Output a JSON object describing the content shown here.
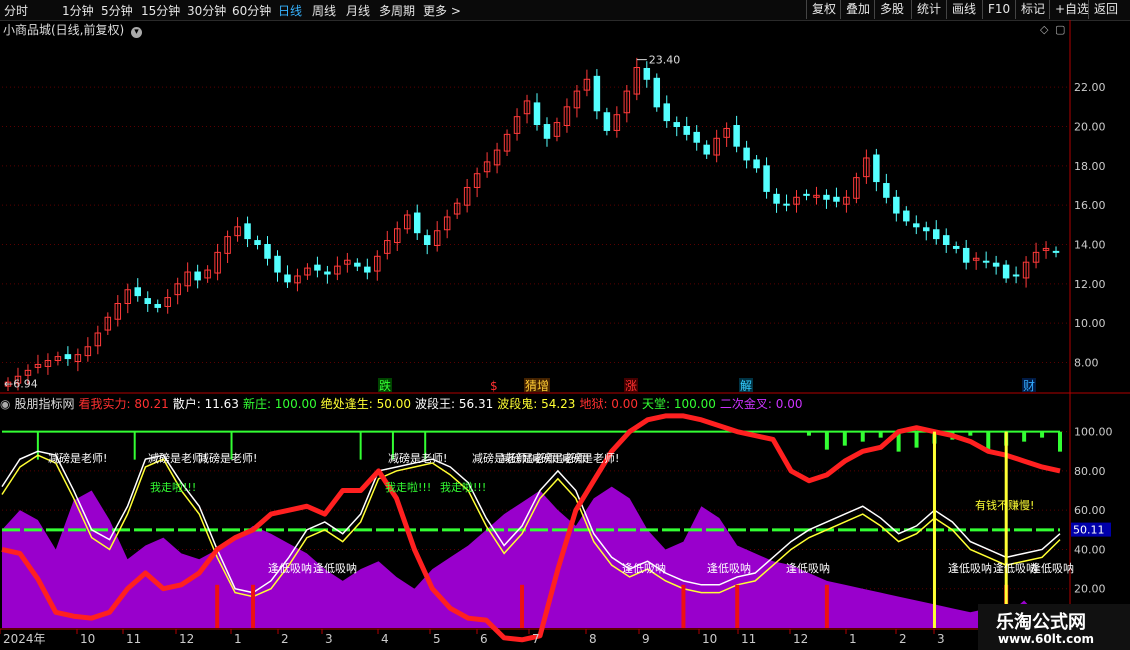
{
  "toolbar": {
    "periods": [
      "分时",
      "1分钟",
      "5分钟",
      "15分钟",
      "30分钟",
      "60分钟",
      "日线",
      "周线",
      "月线",
      "多周期",
      "更多 >"
    ],
    "active_period": "日线",
    "tools": [
      "复权",
      "叠加",
      "多股",
      "统计",
      "画线",
      "F10",
      "标记",
      "+自选",
      "返回"
    ]
  },
  "main_title": "小商品城(日线,前复权)",
  "indicator": {
    "name": "股朋指标网",
    "items": [
      {
        "label": "看我实力:",
        "value": "80.21",
        "color": "#ff3030"
      },
      {
        "label": "散户:",
        "value": "11.63",
        "color": "#ffffff"
      },
      {
        "label": "新庄:",
        "value": "100.00",
        "color": "#33ff33"
      },
      {
        "label": "绝处逢生:",
        "value": "50.00",
        "color": "#ffff33"
      },
      {
        "label": "波段王:",
        "value": "56.31",
        "color": "#ffffff"
      },
      {
        "label": "波段鬼:",
        "value": "54.23",
        "color": "#ffff33"
      },
      {
        "label": "地狱:",
        "value": "0.00",
        "color": "#ff3030"
      },
      {
        "label": "天堂:",
        "value": "100.00",
        "color": "#33ff33"
      },
      {
        "label": "二次金叉:",
        "value": "0.00",
        "color": "#cc33ff"
      }
    ],
    "current_value_label": "50.11",
    "texts": {
      "teacher": "减磅是老师!",
      "run": "我走啦!!!",
      "buy_low": "逢低吸呐",
      "money": "有钱不赚慢!"
    }
  },
  "signals": [
    {
      "text": "跌",
      "color": "#33ff33",
      "bg": "#004400"
    },
    {
      "text": "$",
      "color": "#ff3030",
      "bg": ""
    },
    {
      "text": "猜增",
      "color": "#ffcc33",
      "bg": "#442200"
    },
    {
      "text": "涨",
      "color": "#ff3030",
      "bg": "#440000"
    },
    {
      "text": "解",
      "color": "#33ccff",
      "bg": "#003344"
    },
    {
      "text": "财",
      "color": "#33aaff",
      "bg": "#001a44"
    }
  ],
  "x_labels": [
    "2024年",
    "10",
    "11",
    "12",
    "1",
    "2",
    "3",
    "4",
    "5",
    "6",
    "7",
    "8",
    "9",
    "10",
    "11",
    "12",
    "1",
    "2",
    "3"
  ],
  "watermark": {
    "line1": "乐淘公式网",
    "line2": "www.60lt.com"
  },
  "chart_data": [
    {
      "type": "candlestick",
      "title": "小商品城(日线,前复权)",
      "ylim": [
        6.5,
        24.5
      ],
      "y_ticks": [
        8.0,
        10.0,
        12.0,
        14.0,
        16.0,
        18.0,
        20.0,
        22.0
      ],
      "annotations": [
        {
          "label": "6.94",
          "note": "low"
        },
        {
          "label": "23.40",
          "note": "high"
        }
      ],
      "close_approx": [
        7.0,
        7.3,
        7.6,
        7.9,
        8.1,
        8.3,
        8.2,
        8.4,
        8.8,
        9.5,
        10.3,
        11.0,
        11.7,
        11.4,
        11.0,
        10.8,
        11.3,
        12.0,
        12.6,
        12.2,
        12.7,
        13.6,
        14.4,
        14.9,
        14.3,
        14.0,
        13.3,
        12.6,
        12.1,
        12.4,
        12.8,
        12.7,
        12.5,
        12.9,
        13.2,
        12.9,
        12.6,
        13.4,
        14.2,
        14.8,
        15.5,
        14.6,
        14.0,
        14.7,
        15.4,
        16.1,
        16.9,
        17.6,
        18.2,
        18.8,
        19.6,
        20.5,
        21.3,
        20.1,
        19.4,
        20.2,
        21.0,
        21.8,
        22.4,
        20.8,
        19.8,
        20.6,
        21.8,
        23.0,
        22.4,
        21.0,
        20.3,
        20.0,
        19.6,
        19.2,
        18.6,
        19.4,
        19.9,
        19.0,
        18.3,
        17.9,
        16.7,
        16.1,
        16.0,
        16.4,
        16.5,
        16.5,
        16.3,
        16.2,
        16.4,
        17.4,
        18.4,
        17.2,
        16.4,
        15.6,
        15.2,
        14.9,
        14.7,
        14.3,
        14.0,
        13.8,
        13.1,
        13.3,
        13.1,
        12.9,
        12.3,
        12.4,
        13.1,
        13.6,
        13.8,
        13.6
      ]
    },
    {
      "type": "line",
      "title": "股朋指标网",
      "ylim": [
        0,
        110
      ],
      "y_ticks": [
        20.0,
        40.0,
        60.0,
        80.0,
        100.0
      ],
      "series": [
        {
          "name": "看我实力",
          "color": "#ff2020",
          "values": [
            40,
            38,
            25,
            8,
            6,
            5,
            8,
            20,
            28,
            20,
            22,
            28,
            40,
            46,
            50,
            58,
            60,
            62,
            58,
            70,
            70,
            80,
            66,
            40,
            20,
            10,
            5,
            4,
            -5,
            -6,
            -4,
            30,
            60,
            75,
            90,
            100,
            106,
            108,
            108,
            106,
            103,
            100,
            98,
            96,
            80,
            75,
            78,
            85,
            90,
            92,
            100,
            102,
            100,
            98,
            95,
            90,
            88,
            85,
            82,
            80
          ]
        },
        {
          "name": "波段王",
          "color": "#ffffff",
          "values": [
            72,
            86,
            90,
            88,
            70,
            50,
            45,
            62,
            86,
            88,
            74,
            62,
            40,
            20,
            18,
            24,
            36,
            50,
            54,
            48,
            58,
            80,
            82,
            84,
            86,
            82,
            74,
            56,
            42,
            52,
            70,
            80,
            70,
            48,
            36,
            30,
            34,
            28,
            24,
            22,
            22,
            26,
            28,
            36,
            44,
            50,
            54,
            58,
            62,
            56,
            48,
            52,
            60,
            54,
            44,
            40,
            36,
            38,
            40,
            48
          ]
        },
        {
          "name": "波段鬼",
          "color": "#ffff33",
          "values": [
            68,
            82,
            88,
            84,
            66,
            46,
            40,
            58,
            82,
            86,
            70,
            58,
            36,
            18,
            16,
            20,
            32,
            46,
            50,
            44,
            54,
            76,
            80,
            82,
            84,
            78,
            70,
            52,
            38,
            48,
            66,
            76,
            66,
            44,
            32,
            26,
            30,
            24,
            20,
            18,
            18,
            22,
            24,
            32,
            40,
            46,
            50,
            54,
            58,
            52,
            44,
            48,
            56,
            50,
            40,
            36,
            32,
            34,
            36,
            45
          ]
        },
        {
          "name": "新庄",
          "color": "#33ff33",
          "values": [
            100,
            100,
            100,
            100,
            100,
            100,
            100,
            100,
            100,
            100,
            100,
            100,
            100,
            100,
            100,
            100,
            100,
            100,
            100,
            100,
            100,
            100,
            100,
            100,
            100,
            100,
            100,
            100,
            100,
            100,
            100,
            100,
            100,
            100,
            100,
            100,
            100,
            100,
            100,
            100,
            100,
            100,
            100,
            100,
            100,
            100,
            100,
            100,
            100,
            100,
            100,
            100,
            100,
            100,
            100,
            100,
            100,
            100,
            100,
            100
          ]
        },
        {
          "name": "绝处逢生",
          "color": "#33ff33",
          "values": [
            50,
            50,
            50,
            50,
            50,
            50,
            50,
            50,
            50,
            50,
            50,
            50,
            50,
            50,
            50,
            50,
            50,
            50,
            50,
            50,
            50,
            50,
            50,
            50,
            50,
            50,
            50,
            50,
            50,
            50,
            50,
            50,
            50,
            50,
            50,
            50,
            50,
            50,
            50,
            50,
            50,
            50,
            50,
            50,
            50,
            50,
            50,
            50,
            50,
            50,
            50,
            50,
            50,
            50,
            50,
            50,
            50,
            50,
            50,
            50
          ]
        },
        {
          "name": "散户",
          "color": "#9900cc",
          "values": [
            50,
            60,
            55,
            40,
            65,
            70,
            55,
            35,
            42,
            46,
            38,
            35,
            40,
            45,
            52,
            48,
            43,
            38,
            30,
            24,
            30,
            34,
            26,
            20,
            30,
            36,
            42,
            50,
            58,
            64,
            70,
            60,
            52,
            66,
            72,
            66,
            50,
            40,
            44,
            62,
            56,
            42,
            38,
            34,
            32,
            28,
            24,
            22,
            20,
            18,
            16,
            14,
            12,
            10,
            8,
            10,
            6,
            14,
            4,
            6
          ]
        }
      ]
    }
  ]
}
